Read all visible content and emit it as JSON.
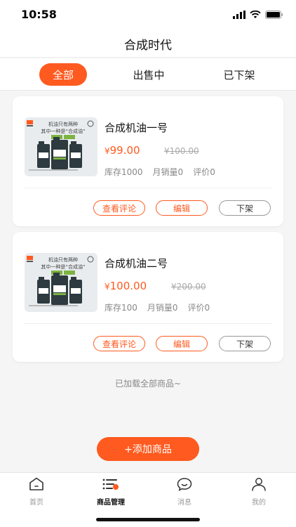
{
  "status": {
    "time": "10:58"
  },
  "nav": {
    "title": "合成时代"
  },
  "tabs": [
    {
      "label": "全部",
      "active": true
    },
    {
      "label": "出售中",
      "active": false
    },
    {
      "label": "已下架",
      "active": false
    }
  ],
  "products": [
    {
      "name": "合成机油一号",
      "price_symbol": "¥",
      "price": "99.00",
      "old_price": "¥100.00",
      "stock": "库存1000",
      "monthly_sales": "月销量0",
      "reviews": "评价0",
      "btn_reviews": "查看评论",
      "btn_edit": "编辑",
      "btn_delist": "下架",
      "thumb_line1": "机油只有两种",
      "thumb_line2": "其中一种是“合成油”"
    },
    {
      "name": "合成机油二号",
      "price_symbol": "¥",
      "price": "100.00",
      "old_price": "¥200.00",
      "stock": "库存100",
      "monthly_sales": "月销量0",
      "reviews": "评价0",
      "btn_reviews": "查看评论",
      "btn_edit": "编辑",
      "btn_delist": "下架",
      "thumb_line1": "机油只有两种",
      "thumb_line2": "其中一种是“合成油”"
    }
  ],
  "footer": {
    "loaded_text": "已加载全部商品~",
    "add_button": "+添加商品"
  },
  "bottom_nav": [
    {
      "label": "首页",
      "icon": "home-icon",
      "active": false
    },
    {
      "label": "商品管理",
      "icon": "product-list-icon",
      "active": true
    },
    {
      "label": "消息",
      "icon": "message-icon",
      "active": false
    },
    {
      "label": "我的",
      "icon": "profile-icon",
      "active": false
    }
  ],
  "colors": {
    "accent": "#ff5a1f"
  }
}
